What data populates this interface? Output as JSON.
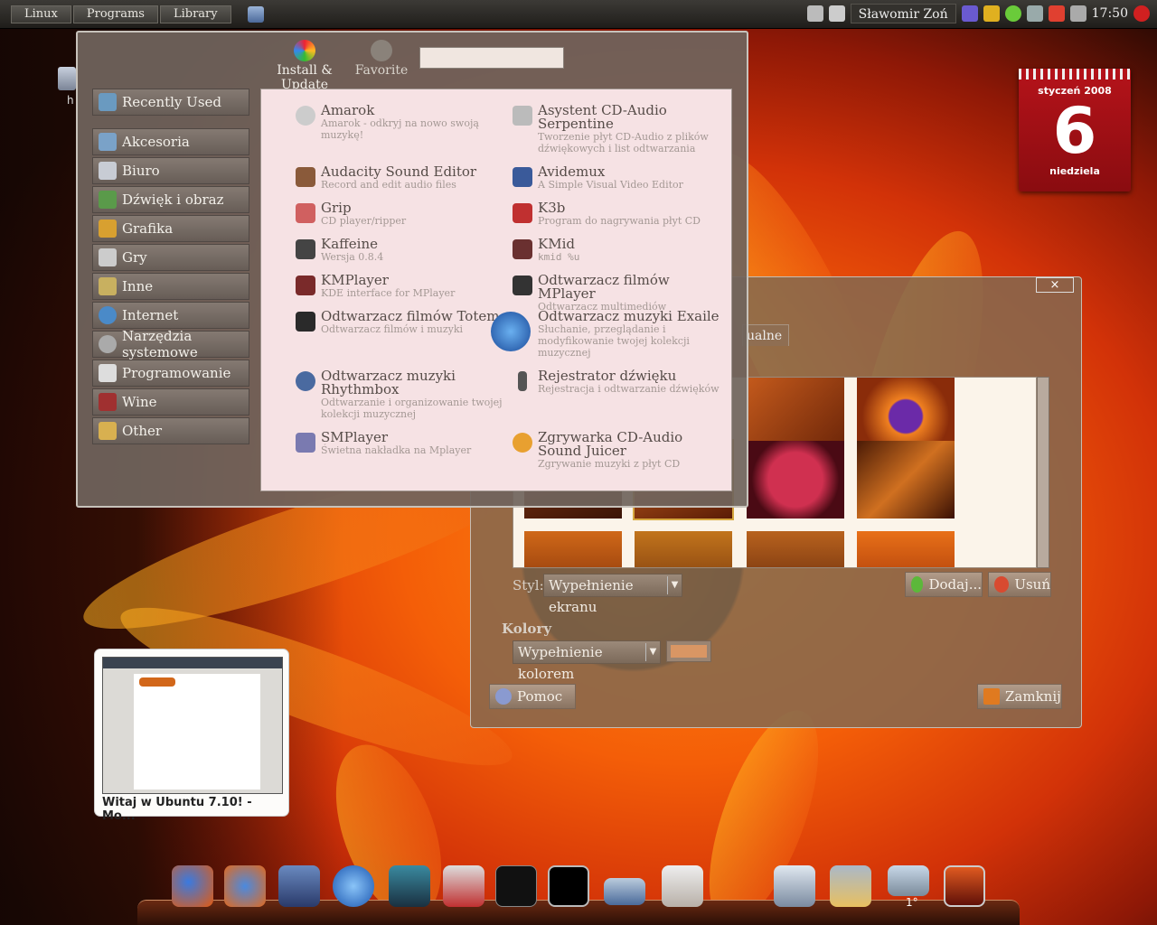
{
  "panel": {
    "menus": [
      "Linux",
      "Programs",
      "Library"
    ],
    "user": "Sławomir Zoń",
    "clock": "17:50"
  },
  "menu": {
    "tabs": {
      "install": "Install & Update",
      "favorite": "Favorite"
    },
    "search_value": "",
    "categories": [
      "Recently Used",
      "Akcesoria",
      "Biuro",
      "Dźwięk i obraz",
      "Grafika",
      "Gry",
      "Inne",
      "Internet",
      "Narzędzia systemowe",
      "Programowanie",
      "Wine",
      "Other"
    ],
    "apps": [
      {
        "name": "Amarok",
        "desc": "Amarok - odkryj na nowo swoją muzykę!"
      },
      {
        "name": "Asystent CD-Audio Serpentine",
        "desc": "Tworzenie płyt CD-Audio z plików dźwiękowych i list odtwarzania"
      },
      {
        "name": "Audacity Sound Editor",
        "desc": "Record and edit audio files"
      },
      {
        "name": "Avidemux",
        "desc": "A Simple Visual Video Editor"
      },
      {
        "name": "Grip",
        "desc": "CD player/ripper"
      },
      {
        "name": "K3b",
        "desc": "Program do nagrywania płyt CD"
      },
      {
        "name": "Kaffeine",
        "desc": "Wersja 0.8.4"
      },
      {
        "name": "KMid",
        "desc": "kmid %u"
      },
      {
        "name": "KMPlayer",
        "desc": "KDE interface for MPlayer"
      },
      {
        "name": "Odtwarzacz filmów MPlayer",
        "desc": "Odtwarzacz multimediów"
      },
      {
        "name": "Odtwarzacz filmów Totem",
        "desc": "Odtwarzacz filmów i muzyki"
      },
      {
        "name": "Odtwarzacz muzyki Exaile",
        "desc": "Słuchanie, przeglądanie i modyfikowanie twojej kolekcji muzycznej"
      },
      {
        "name": "Odtwarzacz muzyki Rhythmbox",
        "desc": "Odtwarzanie i organizowanie twojej kolekcji muzycznej"
      },
      {
        "name": "Rejestrator dźwięku",
        "desc": "Rejestracja i odtwarzanie dźwięków"
      },
      {
        "name": "SMPlayer",
        "desc": "Świetna nakładka na Mplayer"
      },
      {
        "name": "Zgrywarka CD-Audio Sound Juicer",
        "desc": "Zgrywanie muzyki z płyt CD"
      }
    ]
  },
  "prefs": {
    "close": "×",
    "tab_partial": "ualne",
    "style_label": "Styl:",
    "style_value": "Wypełnienie ekranu",
    "add": "Dodaj...",
    "remove": "Usuń",
    "colors_label": "Kolory",
    "color_mode": "Wypełnienie kolorem",
    "help": "Pomoc",
    "close_btn": "Zamknij"
  },
  "calendar": {
    "month": "styczeń 2008",
    "day": "6",
    "weekday": "niedziela"
  },
  "preview": {
    "title": "Witaj w Ubuntu 7.10! - Mo..."
  },
  "desktop": {
    "label": "h"
  },
  "dock": {
    "temperature": "1°",
    "items": [
      "firefox-icon",
      "thunderbird-icon",
      "movie-editor-icon",
      "media-player-icon",
      "music-icon",
      "graphics-icon",
      "widgets-icon",
      "terminal-icon",
      "scanner-icon",
      "presentation-icon",
      "trash-icon",
      "folder-icon",
      "weather-icon",
      "workspace-switcher-icon"
    ]
  }
}
